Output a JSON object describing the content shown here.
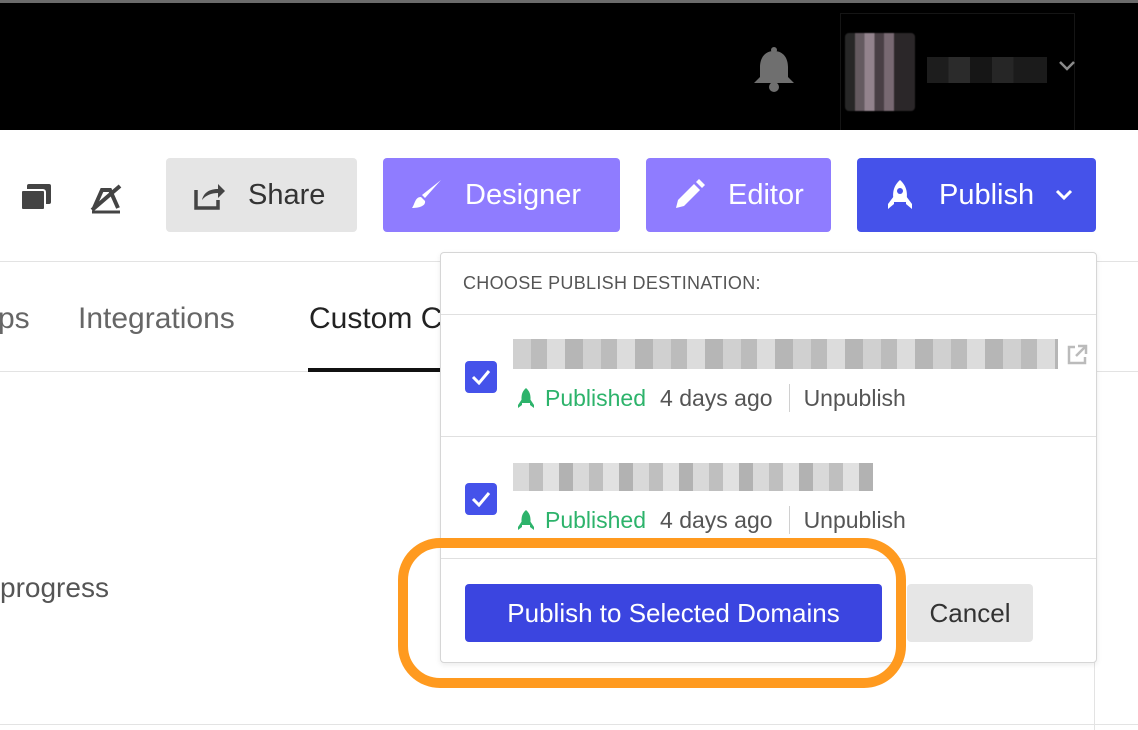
{
  "header": {
    "bell_icon": "bell-icon",
    "user_chevron_icon": "chevron-down-icon"
  },
  "toolbar": {
    "share_label": "Share",
    "designer_label": "Designer",
    "editor_label": "Editor",
    "publish_label": "Publish",
    "icons": [
      "pages-icon",
      "no-edit-icon",
      "share-icon",
      "brush-icon",
      "pencil-icon",
      "rocket-icon"
    ]
  },
  "tabs": [
    {
      "label": "ps"
    },
    {
      "label": "Integrations"
    },
    {
      "label": "Custom C"
    }
  ],
  "main": {
    "progress_text": "progress"
  },
  "publish_dropdown": {
    "header": "CHOOSE PUBLISH DESTINATION:",
    "destinations": [
      {
        "checked": true,
        "status": "Published",
        "time": "4 days ago",
        "action": "Unpublish"
      },
      {
        "checked": true,
        "status": "Published",
        "time": "4 days ago",
        "action": "Unpublish"
      }
    ],
    "publish_button": "Publish to Selected Domains",
    "cancel_button": "Cancel"
  },
  "colors": {
    "primary": "#4552ea",
    "designer": "#8f7cff",
    "published_green": "#2db36b",
    "highlight_orange": "#ff9a1f"
  }
}
